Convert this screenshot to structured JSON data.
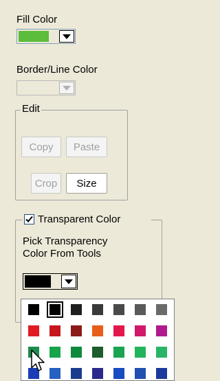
{
  "fill": {
    "label": "Fill Color",
    "color": "#5cbc3c"
  },
  "border": {
    "label": "Border/Line Color",
    "color": "#ece9d8"
  },
  "edit": {
    "title": "Edit",
    "copy_label": "Copy",
    "paste_label": "Paste",
    "crop_label": "Crop",
    "size_label": "Size"
  },
  "transparent": {
    "checkbox_label": "Transparent Color",
    "checked": true,
    "hint_line1": "Pick Transparency",
    "hint_line2": "Color  From Tools",
    "color": "#000000"
  },
  "palette": {
    "rows": [
      [
        "#000000",
        "#000000",
        "#1f1f1f",
        "#3a3a3a",
        "#4a4a4a",
        "#5a5a5a",
        "#6a6a6a"
      ],
      [
        "#e01b24",
        "#c4161c",
        "#8c1a1a",
        "#e85d1a",
        "#e2184d",
        "#d0196a",
        "#b01a8c"
      ],
      [
        "#1e8c4c",
        "#17a34a",
        "#0f8a3c",
        "#1d5c2c",
        "#1aa352",
        "#22b45a",
        "#2ab466"
      ],
      [
        "#1a3cb4",
        "#2660c0",
        "#1a3c8c",
        "#2a2a8c",
        "#1a4cc0",
        "#2050b0",
        "#1c3a9c"
      ]
    ],
    "selected_index": [
      0,
      1
    ]
  },
  "cursor_icon": "arrow-cursor-icon"
}
